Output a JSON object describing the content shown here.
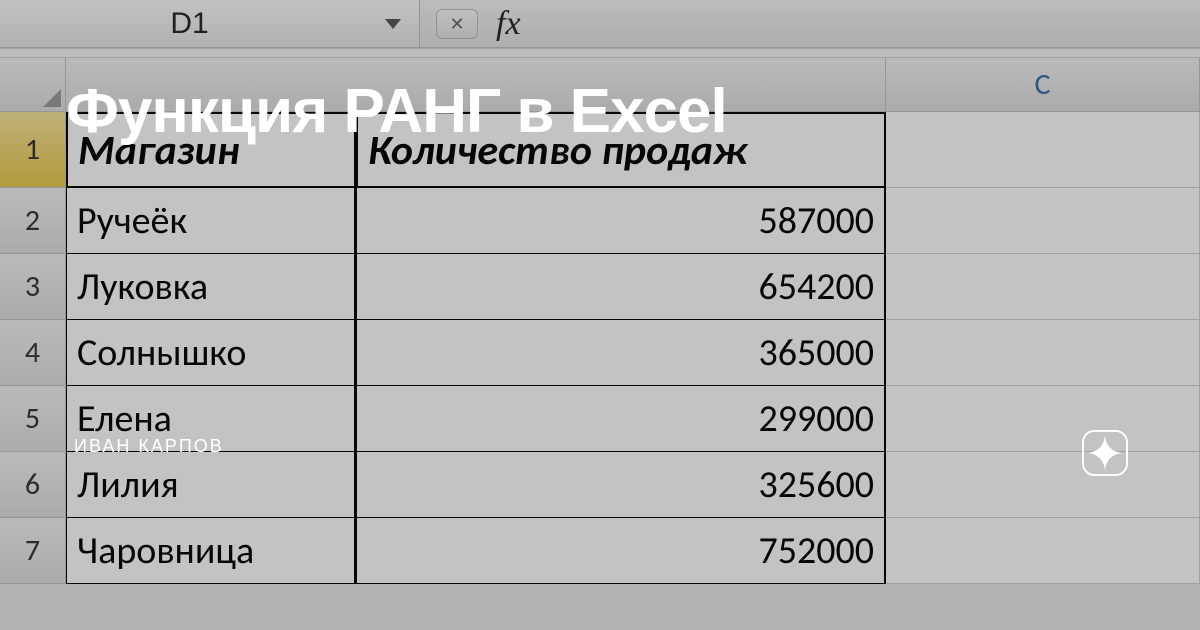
{
  "overlay": {
    "title": "Функция РАНГ в Excel",
    "author": "ИВАН КАРПОВ"
  },
  "formula_bar": {
    "name_box": "D1",
    "fx_label": "fx"
  },
  "columns": {
    "c": "C"
  },
  "headers": {
    "store": "Магазин",
    "sales": "Количество продаж"
  },
  "rows": [
    {
      "n": "1"
    },
    {
      "n": "2",
      "store": "Ручеёк",
      "sales": "587000"
    },
    {
      "n": "3",
      "store": "Луковка",
      "sales": "654200"
    },
    {
      "n": "4",
      "store": "Солнышко",
      "sales": "365000"
    },
    {
      "n": "5",
      "store": "Елена",
      "sales": "299000"
    },
    {
      "n": "6",
      "store": "Лилия",
      "sales": "325600"
    },
    {
      "n": "7",
      "store": "Чаровница",
      "sales": "752000"
    }
  ]
}
